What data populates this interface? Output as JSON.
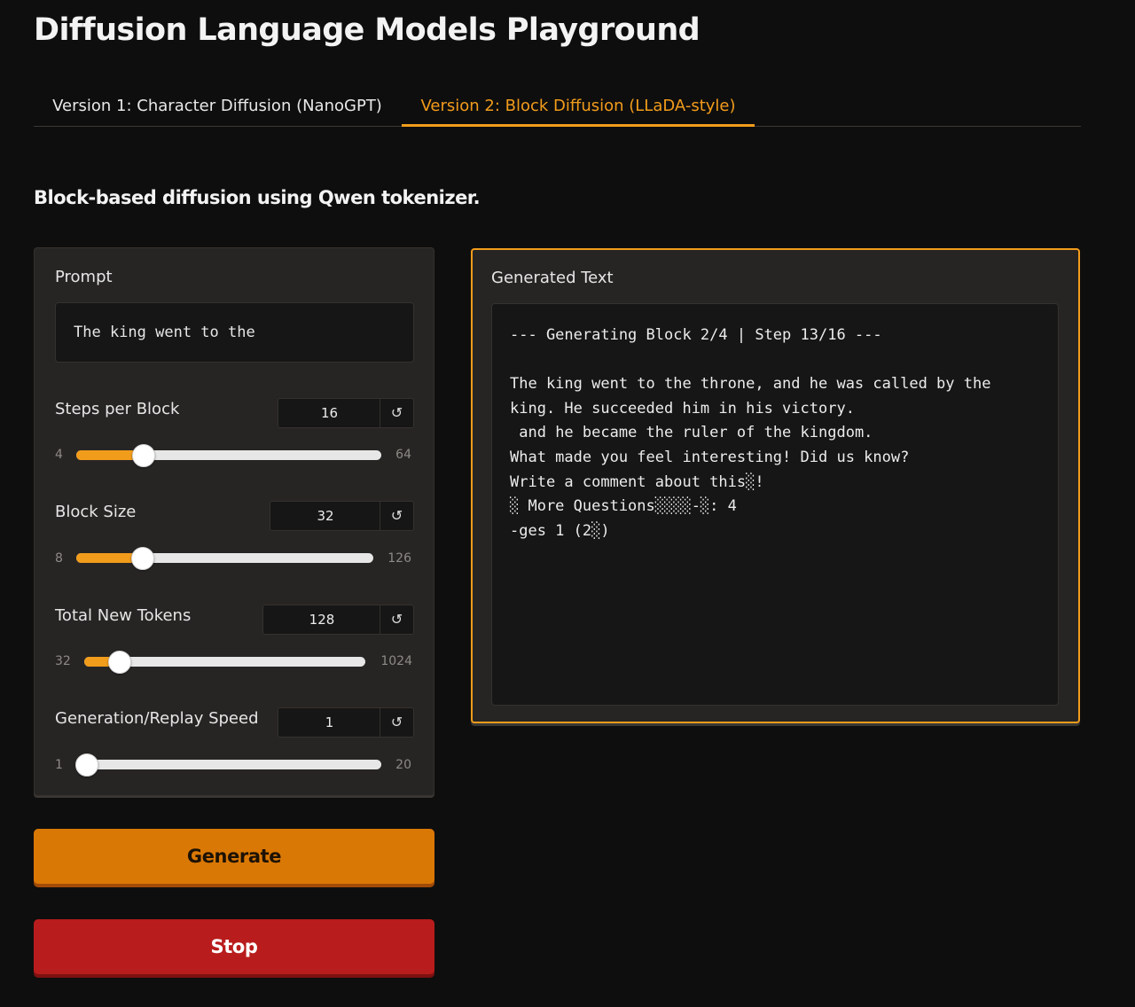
{
  "page": {
    "title": "Diffusion Language Models Playground",
    "subtitle": "Block-based diffusion using Qwen tokenizer."
  },
  "tabs": [
    {
      "label": "Version 1: Character Diffusion (NanoGPT)",
      "active": false
    },
    {
      "label": "Version 2: Block Diffusion (LLaDA-style)",
      "active": true
    }
  ],
  "prompt": {
    "label": "Prompt",
    "value": "The king went to the"
  },
  "controls": {
    "steps_per_block": {
      "label": "Steps per Block",
      "value": "16",
      "min": "4",
      "max": "64",
      "reset_icon": "reset-arrow-icon"
    },
    "block_size": {
      "label": "Block Size",
      "value": "32",
      "min": "8",
      "max": "126",
      "reset_icon": "reset-arrow-icon"
    },
    "total_new_tokens": {
      "label": "Total New Tokens",
      "value": "128",
      "min": "32",
      "max": "1024",
      "reset_icon": "reset-arrow-icon"
    },
    "replay_speed": {
      "label": "Generation/Replay Speed",
      "value": "1",
      "min": "1",
      "max": "20",
      "reset_icon": "reset-arrow-icon"
    }
  },
  "output": {
    "label": "Generated Text",
    "text": "--- Generating Block 2/4 | Step 13/16 ---\n\nThe king went to the throne, and he was called by the king. He succeeded him in his victory.\n and he became the ruler of the kingdom.\nWhat made you feel interesting! Did us know?\nWrite a comment about this░!\n░ More Questions░░░░-░: 4\n-ges 1 (2░)"
  },
  "buttons": {
    "generate": "Generate",
    "stop": "Stop"
  },
  "colors": {
    "accent": "#f29c1b",
    "generate_bg": "#da7805",
    "stop_bg": "#b91c1c",
    "background": "#0f0e0e",
    "panel": "#272524"
  }
}
